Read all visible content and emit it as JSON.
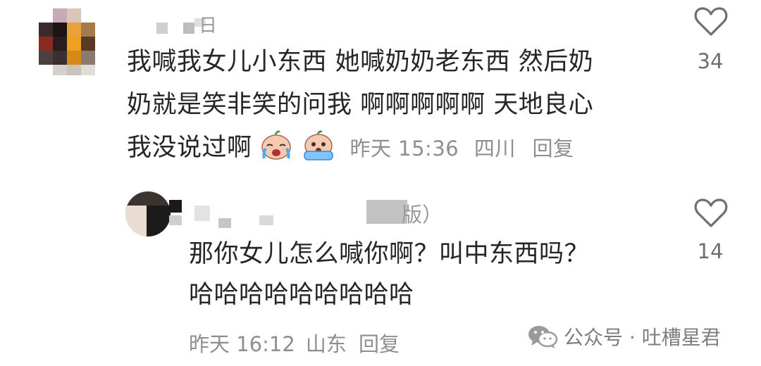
{
  "comment": {
    "author_suffix": "日",
    "text_lines": [
      "我喊我女儿小东西 她喊奶奶老东西 然后奶",
      "奶就是笑非笑的问我 啊啊啊啊啊 天地良心",
      "我没说过啊"
    ],
    "emojis": [
      "crying-face-emoji",
      "sobbing-face-emoji"
    ],
    "time": "昨天 15:36",
    "location": "四川",
    "reply_label": "回复",
    "like_count": "34"
  },
  "reply": {
    "author_suffix": "版）",
    "text_lines": [
      "那你女儿怎么喊你啊？叫中东西吗？",
      "哈哈哈哈哈哈哈哈哈"
    ],
    "time": "昨天 16:12",
    "location": "山东",
    "reply_label": "回复",
    "like_count": "14"
  },
  "watermark": {
    "text": "公众号 · 吐槽星君",
    "icon": "wechat-icon"
  },
  "colors": {
    "text": "#262626",
    "meta": "#8e8e8e",
    "icon": "#6f6f6f"
  }
}
